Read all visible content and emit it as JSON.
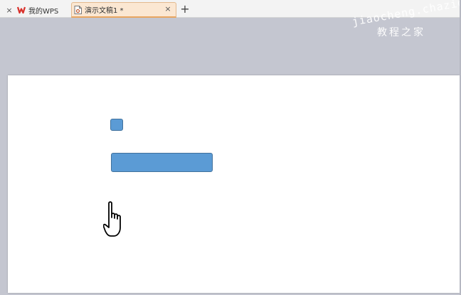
{
  "tabbar": {
    "tabs": [
      {
        "label": "我的WPS",
        "close": "×",
        "icon": "wps-logo-icon",
        "active": false
      },
      {
        "label": "演示文稿1 *",
        "close": "×",
        "icon": "presentation-doc-icon",
        "active": true
      }
    ],
    "new_tab": "+"
  },
  "watermark": {
    "line1": "jiaocheng.chazidian.com",
    "line2": "教程之家"
  },
  "slide": {
    "shapes": [
      {
        "type": "rounded-rectangle",
        "name": "small-square"
      },
      {
        "type": "rounded-rectangle",
        "name": "wide-bar"
      }
    ],
    "cursor": "hand-pointer-icon"
  },
  "colors": {
    "canvas_background": "#c4c6d0",
    "shape_fill": "#5b9bd5",
    "shape_border": "#41719c",
    "active_tab": "#fbe7d2",
    "wps_red": "#d9312b"
  }
}
